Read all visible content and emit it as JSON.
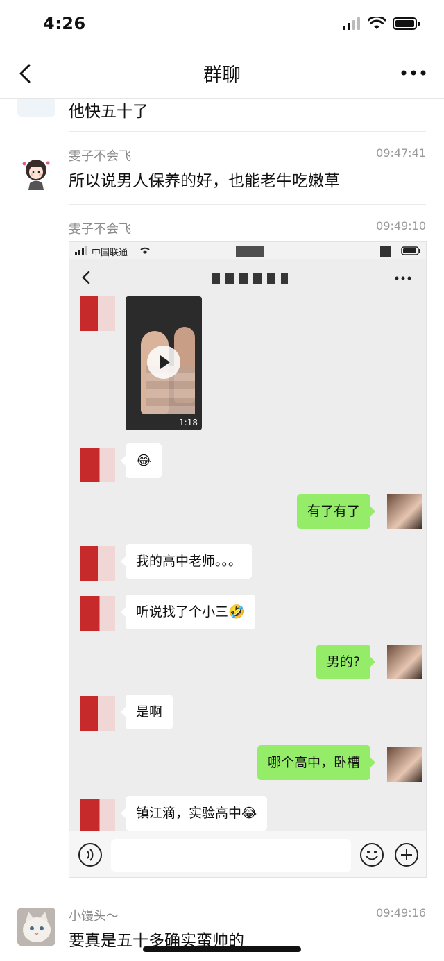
{
  "status": {
    "time": "4:26"
  },
  "nav": {
    "title": "群聊"
  },
  "messages": [
    {
      "text": "他快五十了"
    },
    {
      "sender": "雯子不会飞",
      "time": "09:47:41",
      "text": "所以说男人保养的好，也能老牛吃嫩草"
    },
    {
      "sender": "雯子不会飞",
      "time": "09:49:10"
    },
    {
      "sender": "小馒头～",
      "time": "09:49:16",
      "text": "要真是五十多确实蛮帅的"
    }
  ],
  "screenshot": {
    "carrier": "中国联通",
    "video_duration": "1:18",
    "bubbles": [
      {
        "side": "in",
        "text": "😂"
      },
      {
        "side": "out",
        "text": "有了有了"
      },
      {
        "side": "in",
        "text": "我的高中老师。。。"
      },
      {
        "side": "in",
        "text": "听说找了个小三🤣"
      },
      {
        "side": "out",
        "text": "男的?"
      },
      {
        "side": "in",
        "text": "是啊"
      },
      {
        "side": "out",
        "text": "哪个高中，卧槽"
      },
      {
        "side": "in",
        "text": "镇江滴，实验高中😂"
      }
    ]
  },
  "colors": {
    "bubble_out": "#95ec69",
    "bubble_in": "#ffffff",
    "chat_bg": "#ededed"
  }
}
